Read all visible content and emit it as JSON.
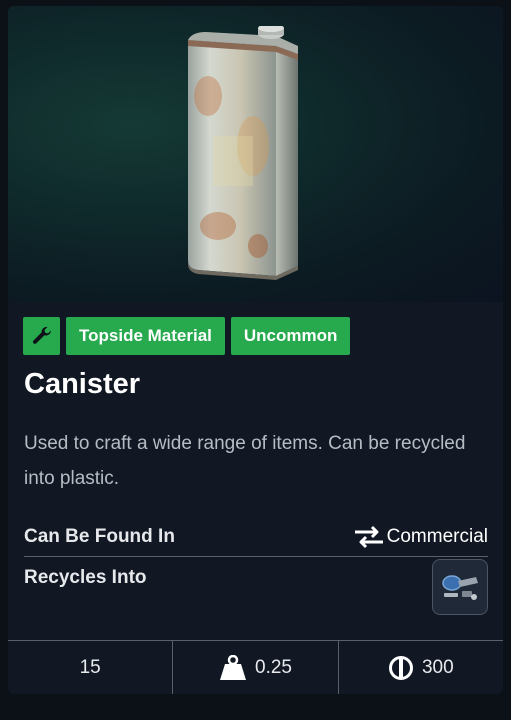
{
  "item": {
    "name": "Canister",
    "description": "Used to craft a wide range of items. Can be recycled into plastic.",
    "image_icon": "canister-image"
  },
  "tags": {
    "category_icon": "wrench-icon",
    "type": "Topside Material",
    "rarity": "Uncommon"
  },
  "details": {
    "found_label": "Can Be Found In",
    "found_icon": "swap-arrows-icon",
    "found_value": "Commercial",
    "recycles_label": "Recycles Into",
    "recycles_icon": "plastic-parts-icon"
  },
  "stats": {
    "stack": "15",
    "weight_icon": "weight-icon",
    "weight": "0.25",
    "value_icon": "coin-icon",
    "value": "300"
  },
  "colors": {
    "tag_green": "#27a94e",
    "card_bg": "#111823"
  }
}
